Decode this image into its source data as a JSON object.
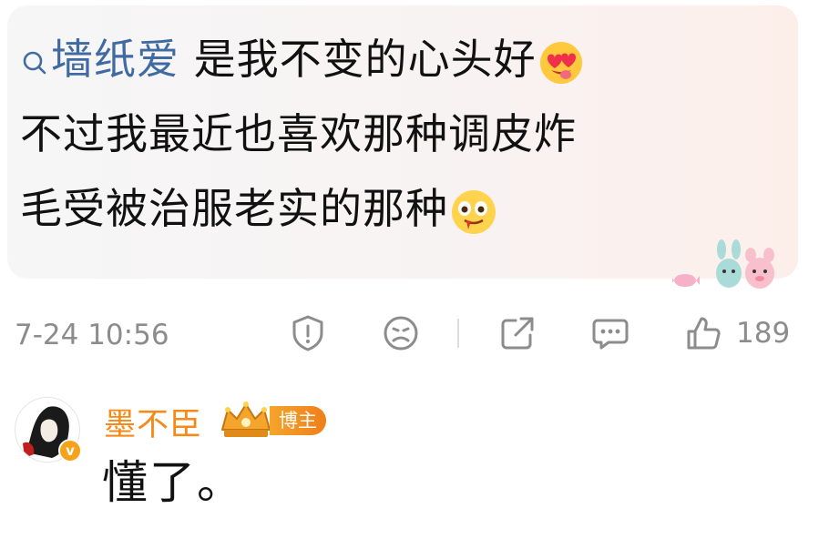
{
  "comment": {
    "topic_text": "墙纸爱",
    "line1_text": "是我不变的心头好",
    "line2_text": "不过我最近也喜欢那种调皮炸",
    "line3_text": "毛受被治服老实的那种",
    "emoji1": "heart-eyes-emoji",
    "emoji2": "drooling-emoji"
  },
  "meta": {
    "timestamp": "7-24 10:56",
    "like_count": "189"
  },
  "reply": {
    "username": "墨不臣",
    "badge_label": "博主",
    "verified_mark": "v",
    "text": "懂了。"
  },
  "colors": {
    "topic_link": "#3f6aa2",
    "username": "#f58a18",
    "badge": "#f4a52b",
    "meta_grey": "#8c8c8c"
  }
}
